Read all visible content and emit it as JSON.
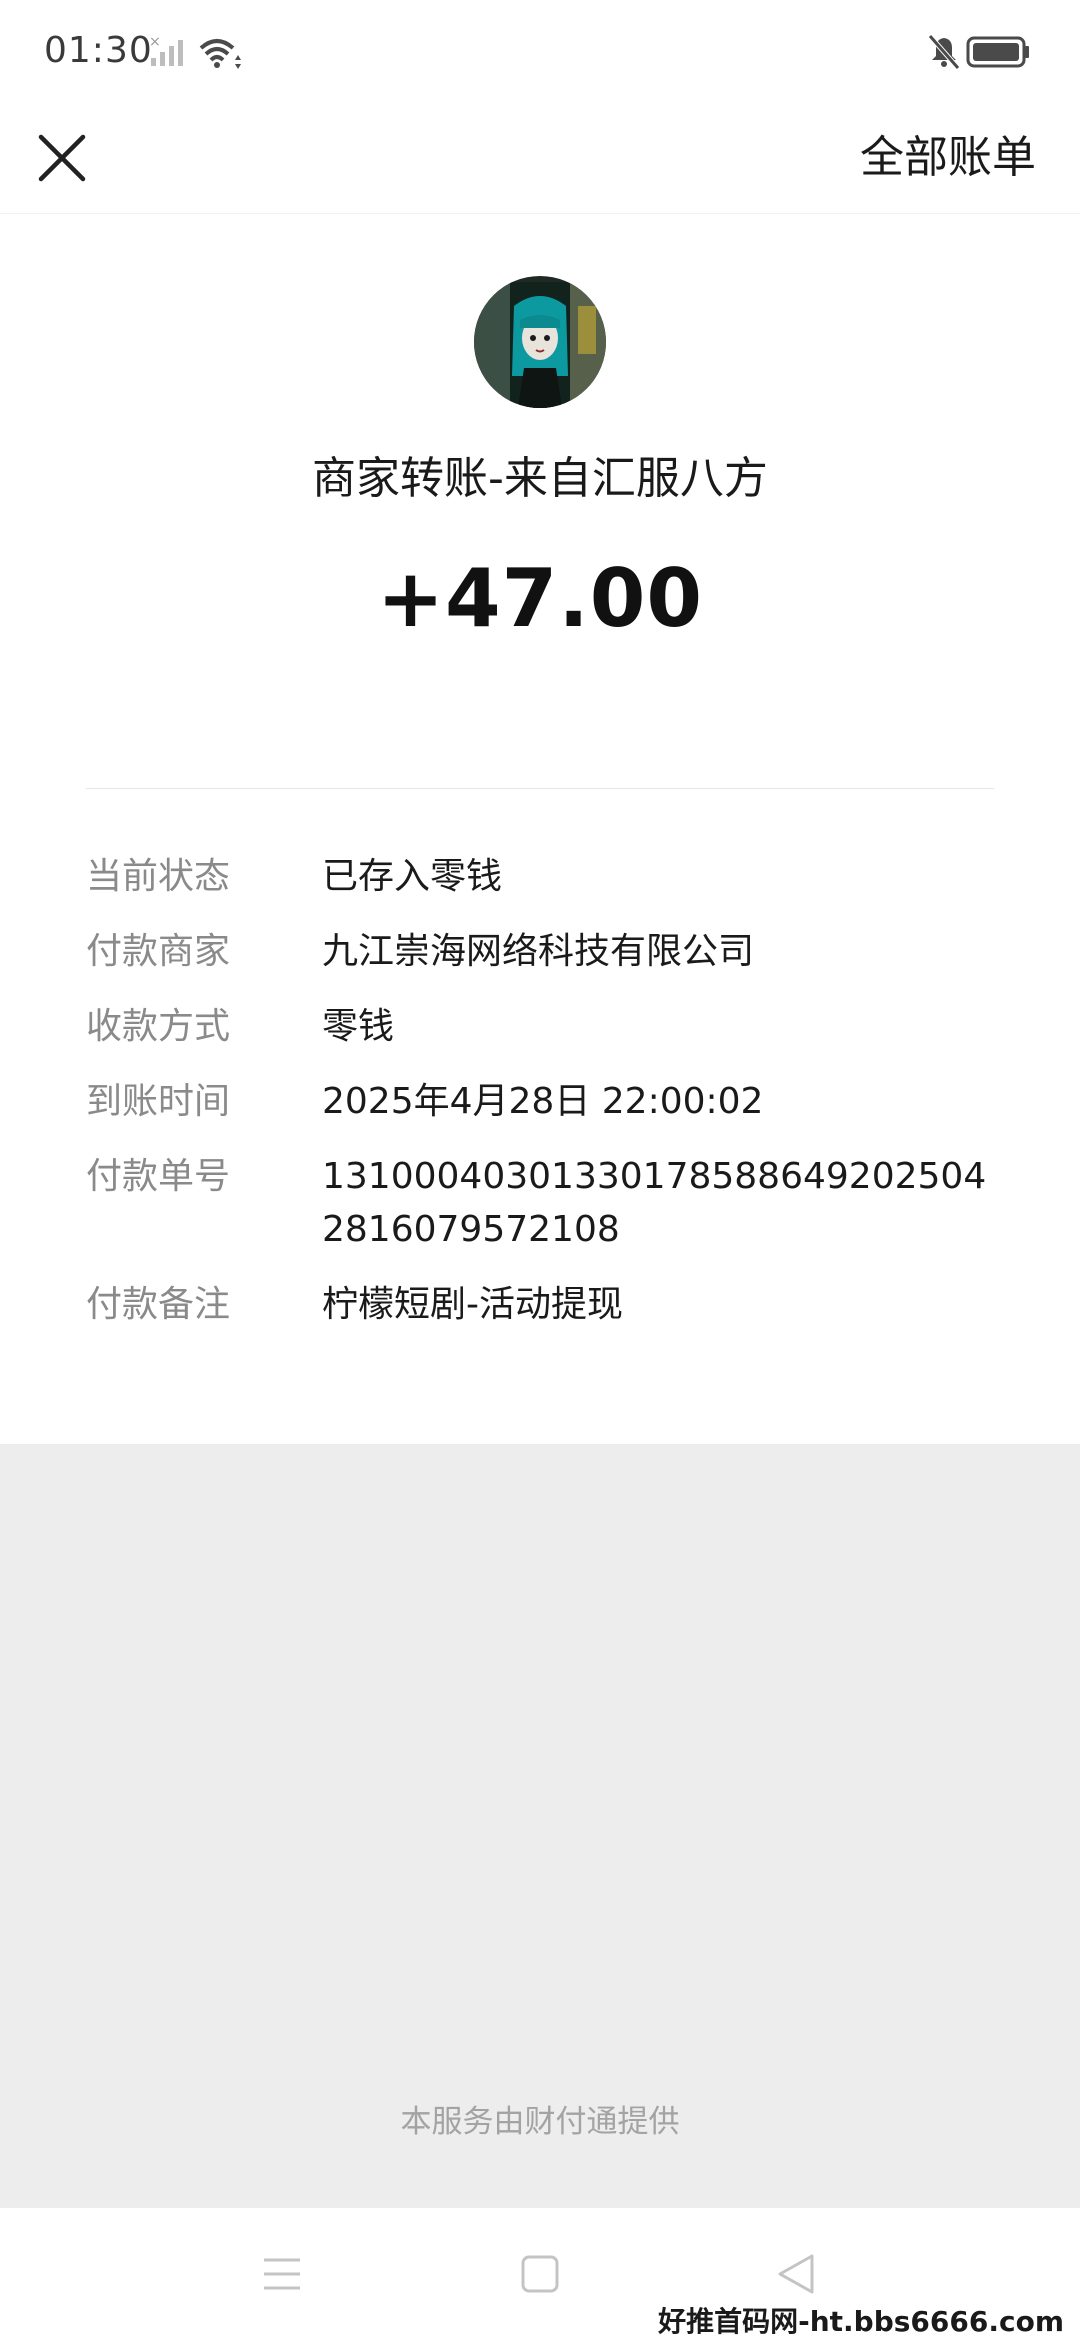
{
  "status_bar": {
    "time": "01:30"
  },
  "header": {
    "close_icon": "close-icon",
    "all_bills_label": "全部账单"
  },
  "transaction": {
    "merchant_title": "商家转账-来自汇服八方",
    "amount": "+47.00",
    "details": [
      {
        "label": "当前状态",
        "value": "已存入零钱"
      },
      {
        "label": "付款商家",
        "value": "九江崇海网络科技有限公司"
      },
      {
        "label": "收款方式",
        "value": "零钱"
      },
      {
        "label": "到账时间",
        "value": "2025年4月28日 22:00:02"
      },
      {
        "label": "付款单号",
        "value": "131000403013301785886492025042816079572108"
      },
      {
        "label": "付款备注",
        "value": "柠檬短剧-活动提现"
      }
    ]
  },
  "footer": {
    "provider": "本服务由财付通提供"
  },
  "watermark": "好推首码网-ht.bbs6666.com",
  "colors": {
    "text_primary": "#1a1a1a",
    "text_secondary": "#8a8a8a",
    "background_gray": "#ededed"
  }
}
